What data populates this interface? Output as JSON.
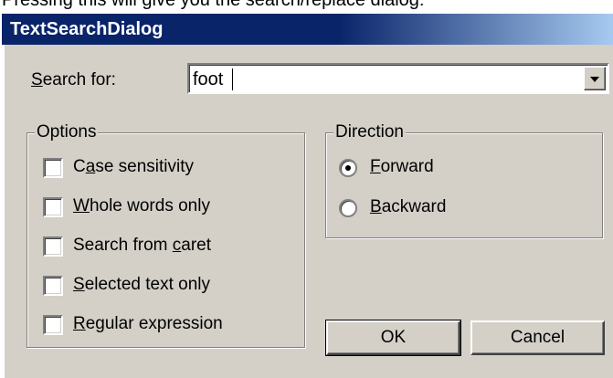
{
  "caption": "Pressing this will give you the search/replace dialog:",
  "window": {
    "title": "TextSearchDialog"
  },
  "search": {
    "label_mnemonic": "S",
    "label_rest": "earch for:",
    "value": "foot"
  },
  "options": {
    "legend": "Options",
    "items": [
      {
        "pre": "C",
        "mn": "a",
        "post": "se sensitivity",
        "checked": false
      },
      {
        "pre": "",
        "mn": "W",
        "post": "hole words only",
        "checked": false
      },
      {
        "pre": "Search from ",
        "mn": "c",
        "post": "aret",
        "checked": false
      },
      {
        "pre": "",
        "mn": "S",
        "post": "elected text only",
        "checked": false
      },
      {
        "pre": "",
        "mn": "R",
        "post": "egular expression",
        "checked": false
      }
    ]
  },
  "direction": {
    "legend": "Direction",
    "items": [
      {
        "mn": "F",
        "post": "orward",
        "selected": true
      },
      {
        "mn": "B",
        "post": "ackward",
        "selected": false
      }
    ]
  },
  "buttons": {
    "ok": "OK",
    "cancel": "Cancel"
  }
}
